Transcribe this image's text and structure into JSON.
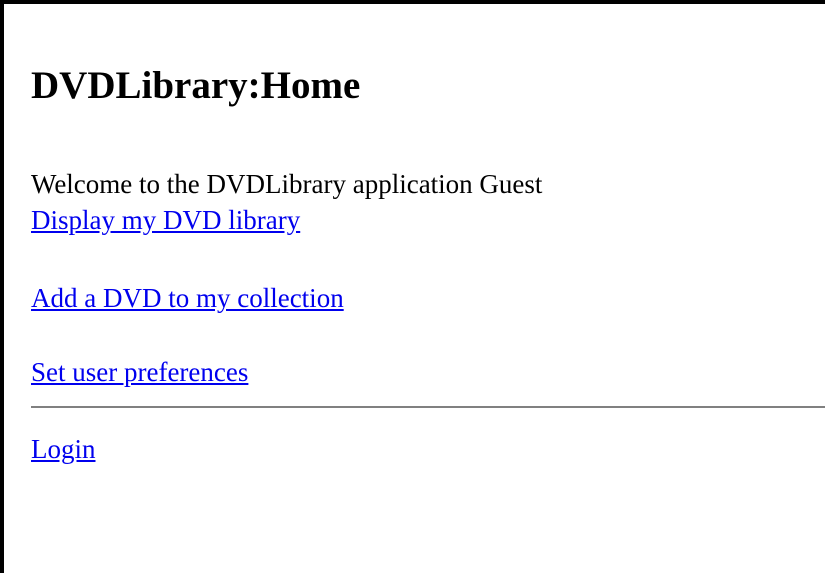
{
  "page": {
    "title": "DVDLibrary:Home",
    "welcome_text": "Welcome to the DVDLibrary application Guest"
  },
  "nav": {
    "display_library": "Display my DVD library",
    "add_dvd": "Add a DVD to my collection",
    "user_preferences": "Set user preferences"
  },
  "auth": {
    "login": "Login"
  },
  "colors": {
    "link": "#0000ee",
    "text": "#000000",
    "divider": "#808080",
    "frame_border": "#000000",
    "background": "#ffffff"
  }
}
